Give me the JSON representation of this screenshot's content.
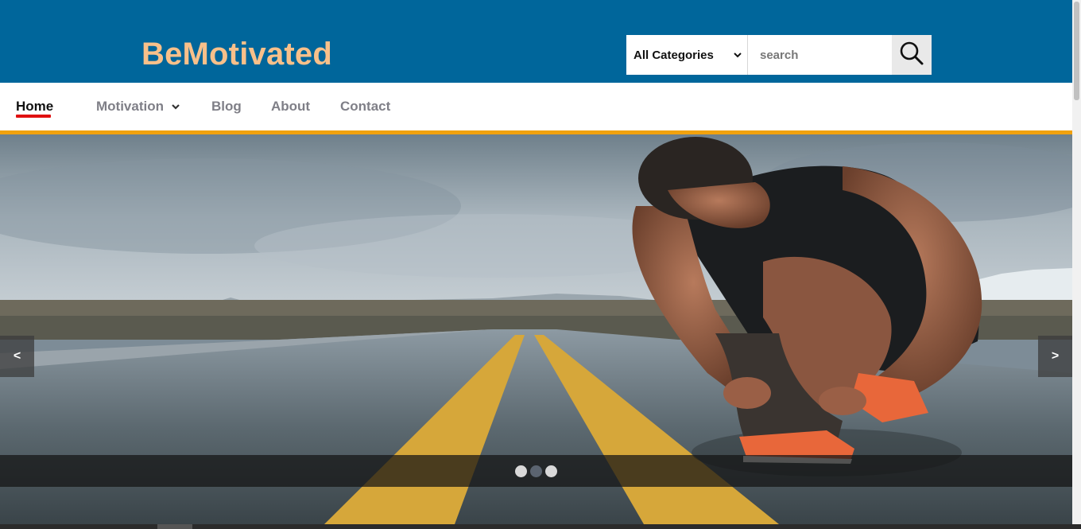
{
  "header": {
    "logo": "BeMotivated",
    "search": {
      "category_selected": "All Categories",
      "placeholder": "search",
      "value": ""
    }
  },
  "nav": {
    "items": [
      {
        "label": "Home",
        "active": true
      },
      {
        "label": "Motivation",
        "dropdown": true
      },
      {
        "label": "Blog"
      },
      {
        "label": "About"
      },
      {
        "label": "Contact"
      }
    ]
  },
  "slider": {
    "prev_label": "<",
    "next_label": ">",
    "slides_count": 3,
    "active_dot": 1,
    "image_description_icon": "runner-on-road-image"
  },
  "colors": {
    "header_bg": "#00669b",
    "logo": "#f8c08a",
    "accent_rule": "#f2a20d",
    "active_underline": "#e01010"
  }
}
